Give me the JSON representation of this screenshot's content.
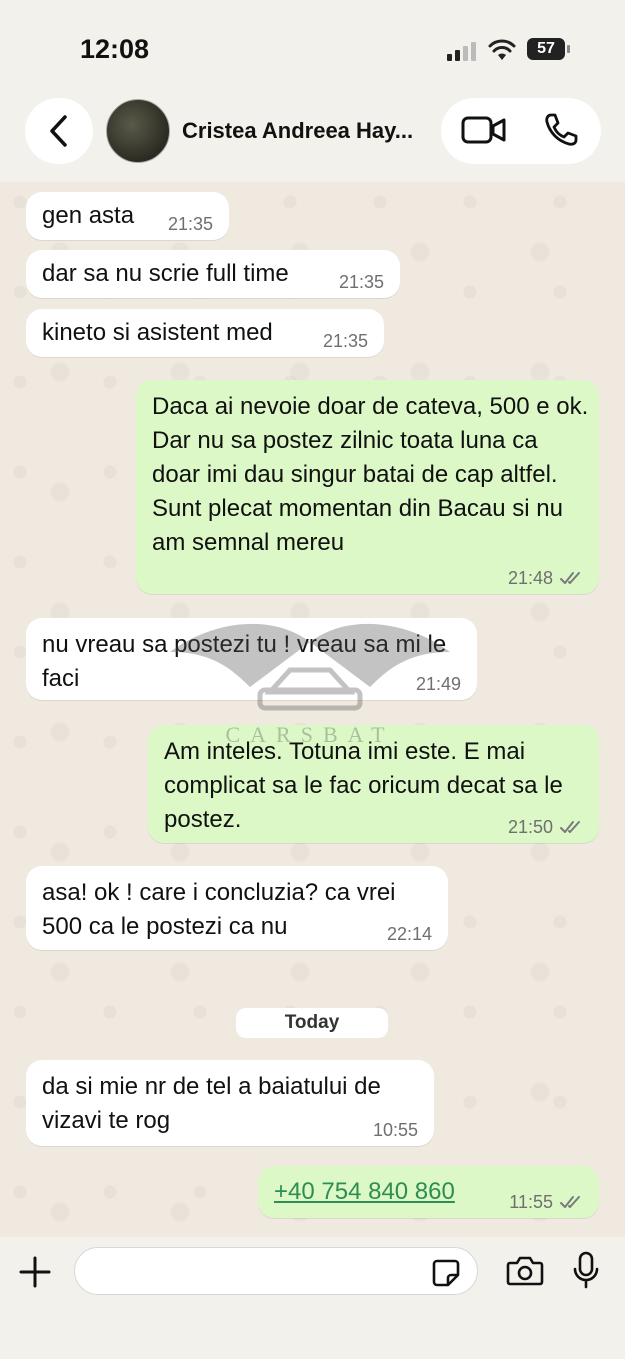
{
  "status_bar": {
    "time": "12:08",
    "battery": "57"
  },
  "header": {
    "contact_name": "Cristea Andreea Hay..."
  },
  "messages": [
    {
      "dir": "in",
      "text": "gen asta",
      "time": "21:35"
    },
    {
      "dir": "in",
      "text": "dar sa nu scrie full time",
      "time": "21:35"
    },
    {
      "dir": "in",
      "text": "kineto si asistent med",
      "time": "21:35"
    },
    {
      "dir": "out",
      "text": "Daca ai nevoie doar de cateva, 500 e ok. Dar nu sa postez zilnic toata luna ca doar imi dau singur batai de cap altfel. Sunt plecat momentan din Bacau si nu am semnal mereu",
      "time": "21:48"
    },
    {
      "dir": "in",
      "text": "nu vreau sa postezi tu ! vreau sa mi le faci",
      "time": "21:49"
    },
    {
      "dir": "out",
      "text": "Am inteles. Totuna imi este. E mai complicat sa le fac oricum decat sa le postez.",
      "time": "21:50"
    },
    {
      "dir": "in",
      "text": "asa! ok ! care i concluzia? ca vrei 500 ca le postezi ca nu",
      "time": "22:14"
    },
    {
      "dir": "in",
      "text": "da si mie nr de tel a baiatului de vizavi te rog",
      "time": "10:55"
    },
    {
      "dir": "out",
      "text": "+40 754 840 860",
      "time": "11:55"
    }
  ],
  "date_separator": "Today",
  "watermark": "CARSBAT",
  "colors": {
    "incoming": "#ffffff",
    "outgoing": "#dbf8c6",
    "link": "#2f8d53",
    "background": "#efe9df"
  },
  "icons": [
    "back-icon",
    "video-call-icon",
    "phone-call-icon",
    "plus-icon",
    "sticker-icon",
    "camera-icon",
    "microphone-icon"
  ]
}
